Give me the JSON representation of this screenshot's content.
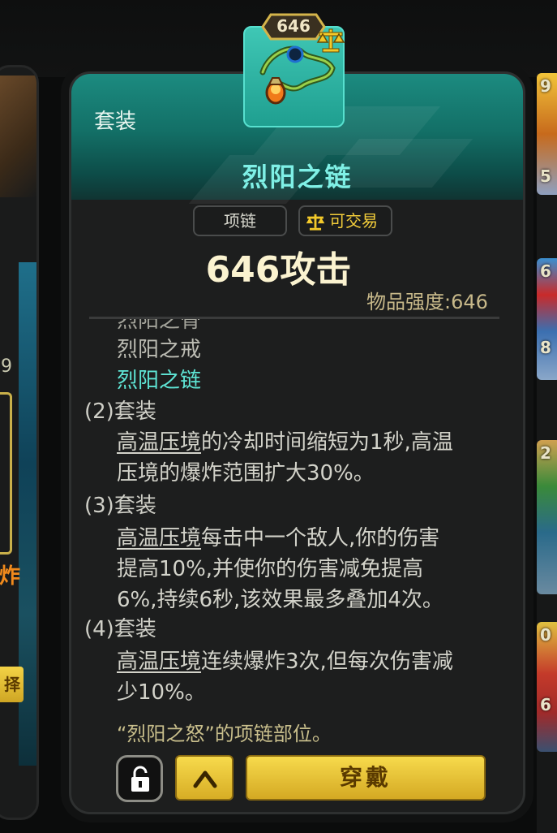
{
  "background": {
    "left_card_number": "9",
    "left_card_text": "炸",
    "left_card_button": "择",
    "right_strip_numbers": [
      "9",
      "5",
      "6",
      "8",
      "2",
      "0",
      "6"
    ]
  },
  "card": {
    "set_label": "套装",
    "item_name": "烈阳之链",
    "power_badge": "646",
    "item_type": "项链",
    "tradable_label": "可交易",
    "attack_text": "646攻击",
    "strength_text": "物品强度:646",
    "set_pieces": [
      "烈阳之骨",
      "烈阳之戒",
      "烈阳之链"
    ],
    "bonus_2": {
      "header": "(2)套装",
      "skill": "高温压境",
      "line1_rest": "的冷却时间缩短为1秒,高温",
      "line2": "压境的爆炸范围扩大30%。"
    },
    "bonus_3": {
      "header": "(3)套装",
      "skill": "高温压境",
      "line1_rest": "每击中一个敌人,你的伤害",
      "line2": "提高10%,并使你的伤害减免提高",
      "line3": "6%,持续6秒,该效果最多叠加4次。"
    },
    "bonus_4": {
      "header": "(4)套装",
      "skill": "高温压境",
      "line1_rest": "连续爆炸3次,但每次伤害减",
      "line2": "少10%。"
    },
    "note": "“烈阳之怒”的项链部位。",
    "equip_button": "穿戴"
  },
  "icons": {
    "lock": "unlock-icon",
    "up": "chevron-up-icon",
    "scale": "scale-icon",
    "item": "necklace-icon"
  },
  "colors": {
    "header_teal": "#137067",
    "title_teal": "#7ff0e6",
    "accent_gold": "#f3cd3a",
    "button_gold": "#f7da4c"
  }
}
